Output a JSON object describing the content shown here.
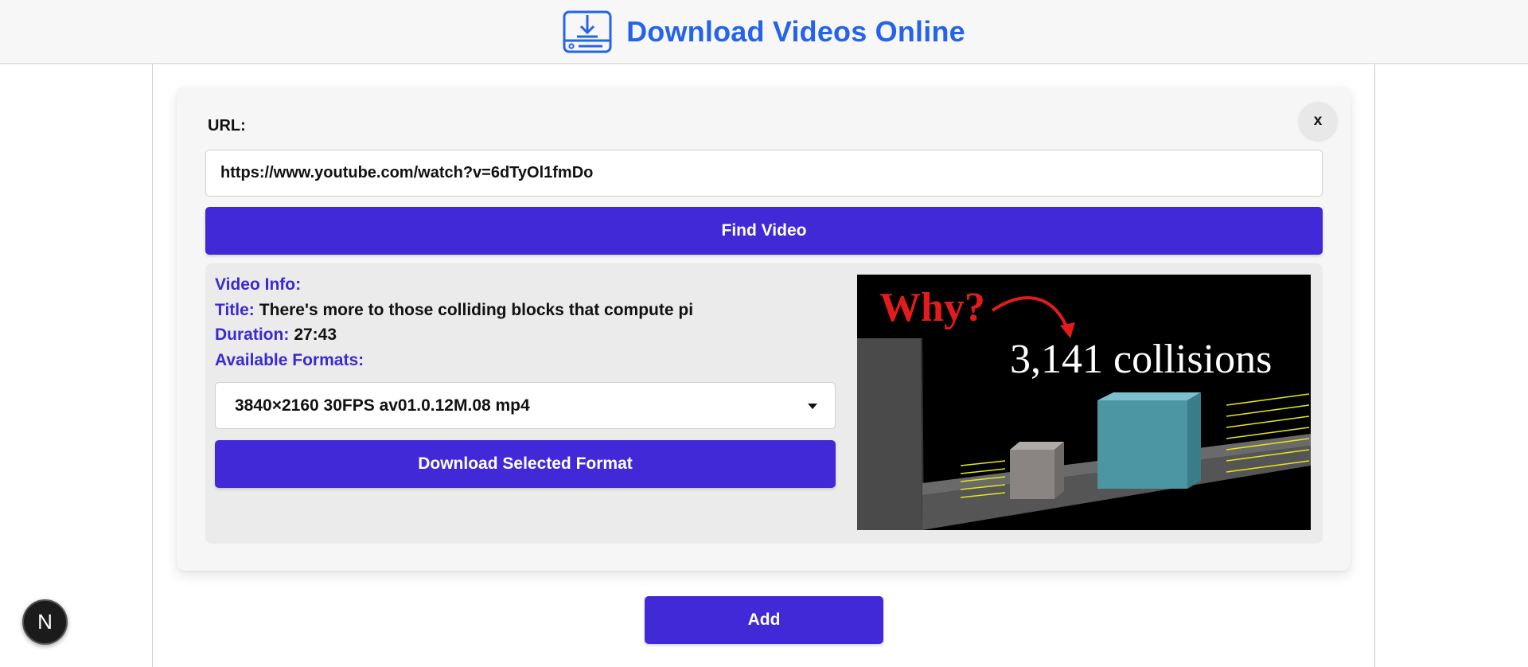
{
  "header": {
    "title": "Download Videos Online",
    "logo_icon": "download-tray-icon"
  },
  "card": {
    "close_label": "x",
    "url_label": "URL:",
    "url_value": "https://www.youtube.com/watch?v=6dTyOl1fmDo",
    "find_button": "Find Video",
    "video_info": {
      "heading": "Video Info:",
      "title_key": "Title:",
      "title_value": "There's more to those colliding blocks that compute pi",
      "duration_key": "Duration:",
      "duration_value": "27:43",
      "formats_key": "Available Formats:",
      "selected_format": "3840×2160 30FPS av01.0.12M.08 mp4",
      "download_button": "Download Selected Format"
    },
    "thumbnail": {
      "why_text": "Why?",
      "collisions_text": "3,141 collisions"
    }
  },
  "add_button": "Add",
  "badge_letter": "N",
  "colors": {
    "accent": "#4229d7",
    "title_blue": "#2563eb",
    "label_purple": "#3a2bd0",
    "why_red": "#e31b1b"
  }
}
